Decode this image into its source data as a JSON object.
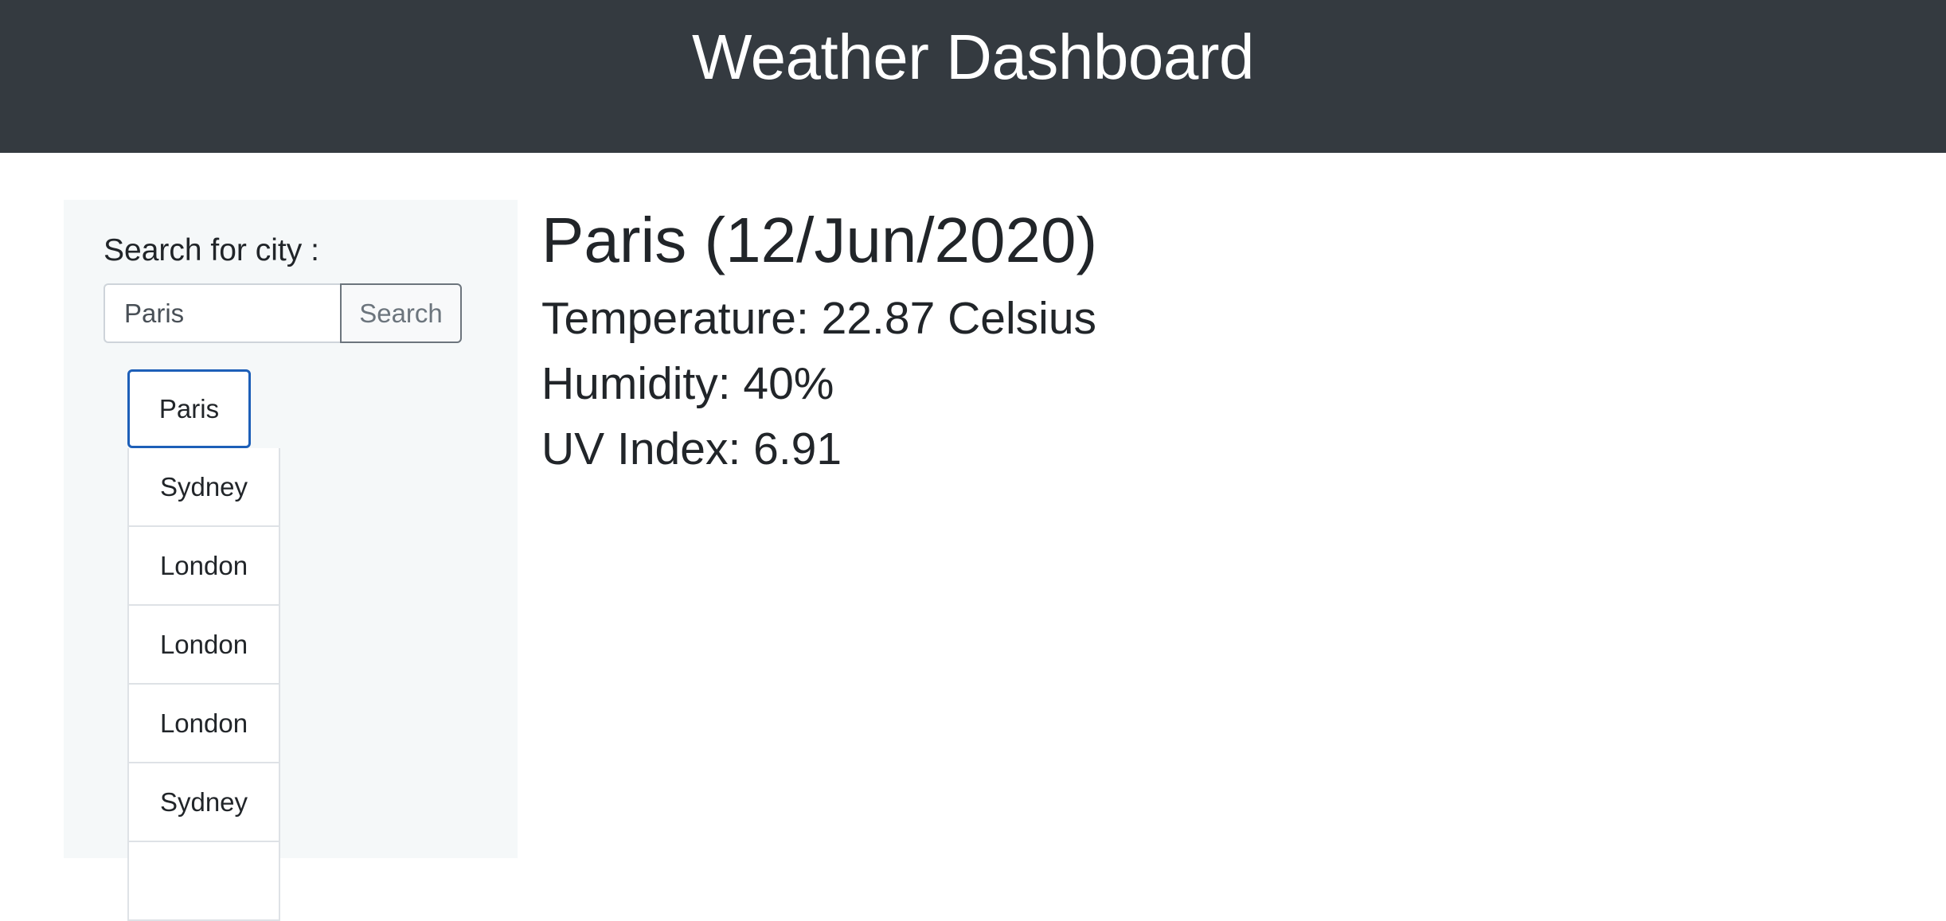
{
  "header": {
    "title": "Weather Dashboard"
  },
  "sidebar": {
    "search_label": "Search for city :",
    "search_value": "Paris",
    "search_button": "Search",
    "cities": [
      {
        "label": "Paris",
        "selected": true
      },
      {
        "label": "Sydney",
        "selected": false
      },
      {
        "label": "London",
        "selected": false
      },
      {
        "label": "London",
        "selected": false
      },
      {
        "label": "London",
        "selected": false
      },
      {
        "label": "Sydney",
        "selected": false
      }
    ]
  },
  "weather": {
    "title": "Paris (12/Jun/2020)",
    "temperature": "Temperature: 22.87 Celsius",
    "humidity": "Humidity: 40%",
    "uv_index": "UV Index: 6.91"
  },
  "colors": {
    "header_bg": "#343a40",
    "sidebar_bg": "#f5f8f9",
    "selected_border": "#1d5fb8"
  }
}
